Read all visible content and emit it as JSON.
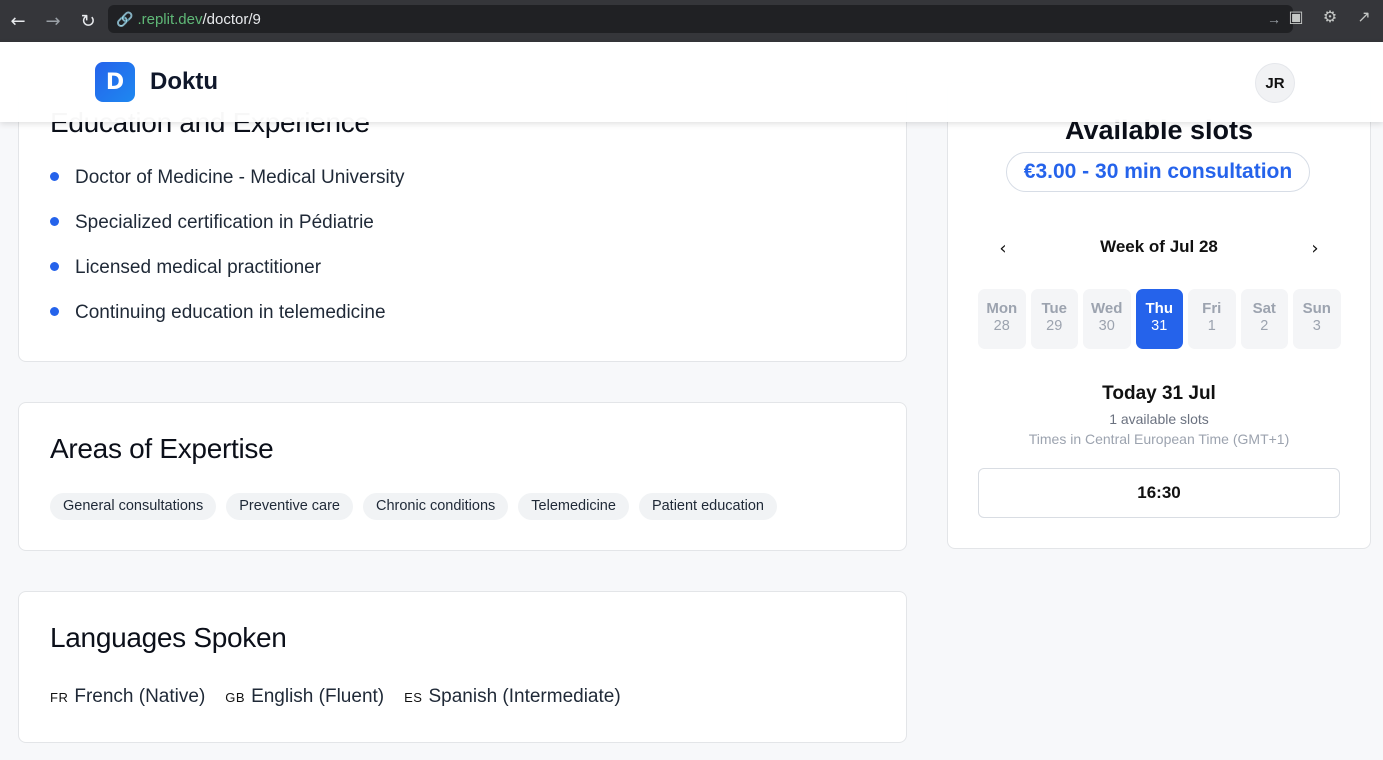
{
  "browser": {
    "url_domain": ".replit.dev",
    "url_path": "/doctor/9"
  },
  "header": {
    "logo_letter": "D",
    "brand": "Doktu",
    "avatar_initials": "JR"
  },
  "education": {
    "title": "Education and Experience",
    "items": [
      "Doctor of Medicine - Medical University",
      "Specialized certification in Pédiatrie",
      "Licensed medical practitioner",
      "Continuing education in telemedicine"
    ]
  },
  "expertise": {
    "title": "Areas of Expertise",
    "tags": [
      "General consultations",
      "Preventive care",
      "Chronic conditions",
      "Telemedicine",
      "Patient education"
    ]
  },
  "languages": {
    "title": "Languages Spoken",
    "items": [
      {
        "code": "FR",
        "label": "French (Native)"
      },
      {
        "code": "GB",
        "label": "English (Fluent)"
      },
      {
        "code": "ES",
        "label": "Spanish (Intermediate)"
      }
    ]
  },
  "slots": {
    "title": "Available slots",
    "price": "€3.00 - 30 min consultation",
    "week_label": "Week of Jul 28",
    "days": [
      {
        "name": "Mon",
        "num": "28"
      },
      {
        "name": "Tue",
        "num": "29"
      },
      {
        "name": "Wed",
        "num": "30"
      },
      {
        "name": "Thu",
        "num": "31"
      },
      {
        "name": "Fri",
        "num": "1"
      },
      {
        "name": "Sat",
        "num": "2"
      },
      {
        "name": "Sun",
        "num": "3"
      }
    ],
    "selected_day": "Thu",
    "today_label": "Today 31 Jul",
    "available_count": "1 available slots",
    "timezone": "Times in Central European Time (GMT+1)",
    "times": [
      "16:30"
    ]
  },
  "colors": {
    "accent": "#2563eb",
    "chrome": "#35363a"
  },
  "icons": {
    "back": "arrow-left-icon",
    "forward": "arrow-right-icon",
    "reload": "reload-icon",
    "link": "link-icon",
    "prev_week": "chevron-left-icon",
    "next_week": "chevron-right-icon"
  }
}
